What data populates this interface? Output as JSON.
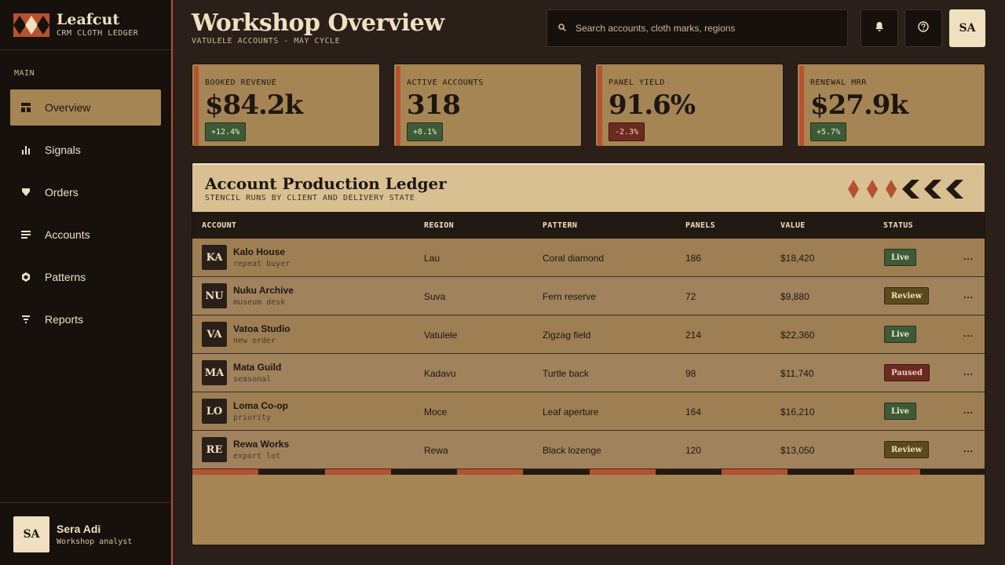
{
  "brand": {
    "name": "Leafcut",
    "tagline": "CRM CLOTH LEDGER"
  },
  "sidebar": {
    "section": "MAIN",
    "items": [
      {
        "label": "Overview",
        "icon": "layout-icon",
        "active": true
      },
      {
        "label": "Signals",
        "icon": "bar-chart-icon"
      },
      {
        "label": "Orders",
        "icon": "shield-icon"
      },
      {
        "label": "Accounts",
        "icon": "list-icon"
      },
      {
        "label": "Patterns",
        "icon": "hexagon-icon"
      },
      {
        "label": "Reports",
        "icon": "filter-icon"
      }
    ]
  },
  "user": {
    "initials": "SA",
    "name": "Sera Adi",
    "role": "Workshop analyst"
  },
  "header": {
    "title": "Workshop Overview",
    "subtitle": "VATULELE ACCOUNTS - MAY CYCLE",
    "search_placeholder": "Search accounts, cloth marks, regions",
    "avatar": "SA"
  },
  "kpis": [
    {
      "label": "BOOKED REVENUE",
      "value": "$84.2k",
      "delta": "+12.4%",
      "trend": "up"
    },
    {
      "label": "ACTIVE ACCOUNTS",
      "value": "318",
      "delta": "+8.1%",
      "trend": "up"
    },
    {
      "label": "PANEL YIELD",
      "value": "91.6%",
      "delta": "-2.3%",
      "trend": "down"
    },
    {
      "label": "RENEWAL MRR",
      "value": "$27.9k",
      "delta": "+5.7%",
      "trend": "up"
    }
  ],
  "ledger": {
    "title": "Account Production Ledger",
    "subtitle": "STENCIL RUNS BY CLIENT AND DELIVERY STATE",
    "columns": [
      "ACCOUNT",
      "REGION",
      "PATTERN",
      "PANELS",
      "VALUE",
      "STATUS"
    ],
    "rows": [
      {
        "initials": "KA",
        "name": "Kalo House",
        "note": "repeat buyer",
        "region": "Lau",
        "pattern": "Coral diamond",
        "panels": "186",
        "value": "$18,420",
        "status": "Live"
      },
      {
        "initials": "NU",
        "name": "Nuku Archive",
        "note": "museum desk",
        "region": "Suva",
        "pattern": "Fern reserve",
        "panels": "72",
        "value": "$9,880",
        "status": "Review"
      },
      {
        "initials": "VA",
        "name": "Vatoa Studio",
        "note": "new order",
        "region": "Vatulele",
        "pattern": "Zigzag field",
        "panels": "214",
        "value": "$22,360",
        "status": "Live"
      },
      {
        "initials": "MA",
        "name": "Mata Guild",
        "note": "seasonal",
        "region": "Kadavu",
        "pattern": "Turtle back",
        "panels": "98",
        "value": "$11,740",
        "status": "Paused"
      },
      {
        "initials": "LO",
        "name": "Loma Co-op",
        "note": "priority",
        "region": "Moce",
        "pattern": "Leaf aperture",
        "panels": "164",
        "value": "$16,210",
        "status": "Live"
      },
      {
        "initials": "RE",
        "name": "Rewa Works",
        "note": "export lot",
        "region": "Rewa",
        "pattern": "Black lozenge",
        "panels": "120",
        "value": "$13,050",
        "status": "Review"
      }
    ],
    "more_label": "..."
  },
  "colors": {
    "accent": "#b8512f",
    "card": "#a68555",
    "dark": "#16110d",
    "cream": "#efe0c0"
  }
}
